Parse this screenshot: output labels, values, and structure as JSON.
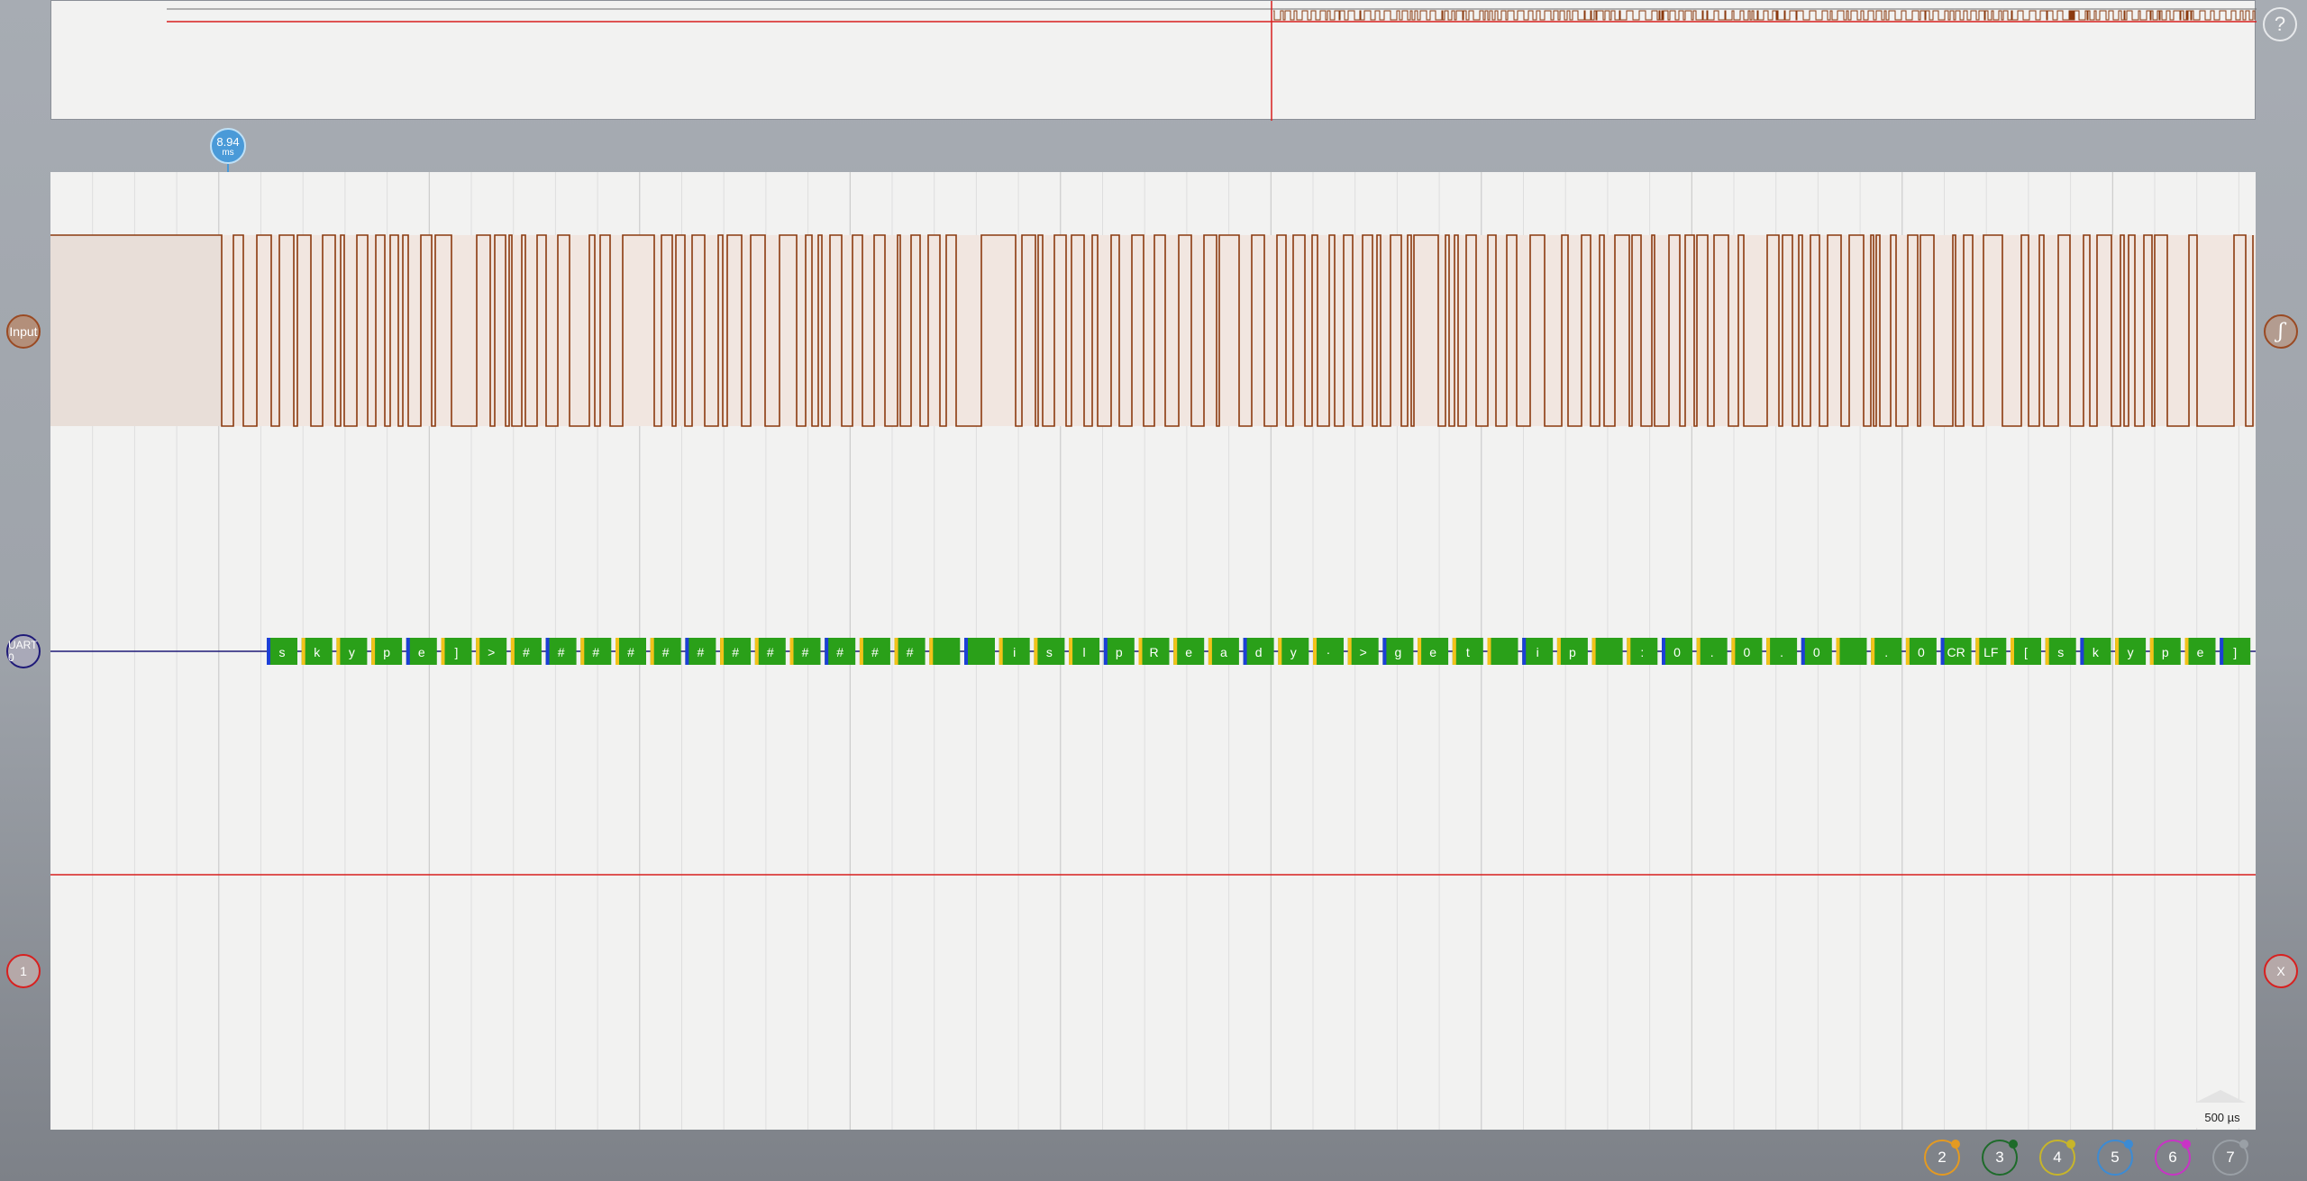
{
  "help": {
    "label": "?"
  },
  "cursor": {
    "value": "8.94",
    "unit": "ms"
  },
  "channels": {
    "input": {
      "label": "Input",
      "color": "#8b3a0f"
    },
    "uart": {
      "label": "UART 0",
      "color": "#1f1a78"
    },
    "analog1": {
      "label": "1",
      "color": "#d8201f"
    },
    "xlabel": {
      "label": "X"
    },
    "trigger_icon": {
      "label": "ʃ",
      "icon": "trigger-edge-icon"
    }
  },
  "timescale": {
    "label": "500 µs"
  },
  "bottom_channels": [
    {
      "label": "2",
      "color": "#e49a21"
    },
    {
      "label": "3",
      "color": "#1e6b2a"
    },
    {
      "label": "4",
      "color": "#c7b52a"
    },
    {
      "label": "5",
      "color": "#3c8bd4"
    },
    {
      "label": "6",
      "color": "#c933c5"
    },
    {
      "label": "7",
      "color": "#9aa0a6"
    }
  ],
  "uart_decoded": [
    "s",
    "k",
    "y",
    "p",
    "e",
    "]",
    ">",
    "#",
    "#",
    "#",
    "#",
    "#",
    "#",
    "#",
    "#",
    "#",
    "#",
    "#",
    "#",
    "",
    "",
    "i",
    "s",
    "l",
    "p",
    "R",
    "e",
    "a",
    "d",
    "y",
    "·",
    ">",
    "g",
    "e",
    "t",
    "",
    "i",
    "p",
    "",
    ":",
    "0",
    ".",
    "0",
    ".",
    "0",
    "",
    ".",
    "0",
    "CR",
    "LF",
    "[",
    "s",
    "k",
    "y",
    "p",
    "e",
    "]",
    ">"
  ],
  "colors": {
    "uart_frame": "#2aa019",
    "uart_start": "#f2c21a",
    "uart_stop": "#1c3fd6",
    "signal": "#8b3a0f",
    "marker_line": "#d8201f"
  }
}
